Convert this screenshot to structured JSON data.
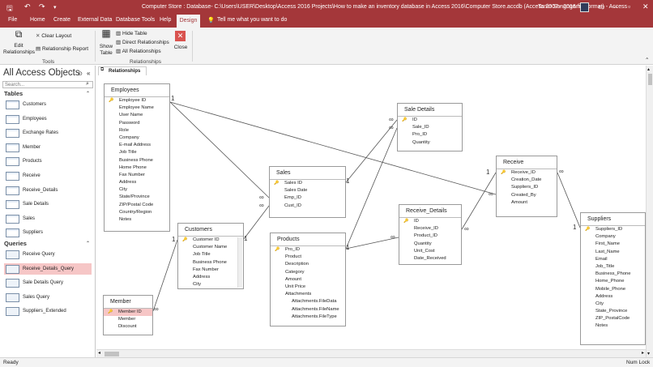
{
  "window": {
    "title": "Computer Store : Database- C:\\Users\\USER\\Desktop\\Access 2016 Projects\\How to make an inventory database in Access 2016\\Computer Store.accdb (Access 2007 - 2016 file format) - Access",
    "user": "Tanin Sangngam"
  },
  "ribbon_tabs": [
    "File",
    "Home",
    "Create",
    "External Data",
    "Database Tools",
    "Help",
    "Design"
  ],
  "tell_me": "Tell me what you want to do",
  "ribbon": {
    "edit_relationships": "Edit\nRelationships",
    "clear_layout": "Clear Layout",
    "relationship_report": "Relationship Report",
    "tools_group": "Tools",
    "show_table": "Show\nTable",
    "hide_table": "Hide Table",
    "direct_relationships": "Direct Relationships",
    "all_relationships": "All Relationships",
    "close": "Close",
    "relationships_group": "Relationships"
  },
  "nav": {
    "title": "All Access Objects",
    "search_placeholder": "Search...",
    "tables_header": "Tables",
    "queries_header": "Queries",
    "tables": [
      "Customers",
      "Employees",
      "Exchange Rates",
      "Member",
      "Products",
      "Receive",
      "Receive_Details",
      "Sale Details",
      "Sales",
      "Suppliers"
    ],
    "queries": [
      "Receive Query",
      "Receive_Details_Query",
      "Sale Details Query",
      "Sales Query",
      "Suppliers_Extended"
    ],
    "selected_query": "Receive_Details_Query"
  },
  "doc_tab": "Relationships",
  "tables": {
    "employees": {
      "name": "Employees",
      "fields": [
        "Employee ID",
        "Employee Name",
        "User Name",
        "Password",
        "Role",
        "Company",
        "E-mail Address",
        "Job Title",
        "Business Phone",
        "Home Phone",
        "Fax Number",
        "Address",
        "City",
        "State/Province",
        "ZIP/Postal Code",
        "Country/Region",
        "Notes"
      ]
    },
    "sale_details": {
      "name": "Sale Details",
      "fields": [
        "ID",
        "Sale_ID",
        "Pro_ID",
        "Quantity"
      ]
    },
    "receive": {
      "name": "Receive",
      "fields": [
        "Receive_ID",
        "Creation_Date",
        "Suppliers_ID",
        "Created_By",
        "Amount"
      ]
    },
    "sales": {
      "name": "Sales",
      "fields": [
        "Sales ID",
        "Sales Date",
        "Emp_ID",
        "Cust_ID"
      ]
    },
    "receive_details": {
      "name": "Receive_Details",
      "fields": [
        "ID",
        "Receive_ID",
        "Product_ID",
        "Quantity",
        "Unit_Cost",
        "Date_Received"
      ]
    },
    "customers": {
      "name": "Customers",
      "fields": [
        "Customer ID",
        "Customer Name",
        "Job Title",
        "Business Phone",
        "Fax Number",
        "Address",
        "City"
      ]
    },
    "products": {
      "name": "Products",
      "fields": [
        "Pro_ID",
        "Product",
        "Description",
        "Category",
        "Amount",
        "Unit Price",
        "Attachments",
        "Attachments.FileData",
        "Attachments.FileName",
        "Attachments.FileType"
      ]
    },
    "suppliers": {
      "name": "Suppliers",
      "fields": [
        "Suppliers_ID",
        "Company",
        "First_Name",
        "Last_Name",
        "Email",
        "Job_Title",
        "Business_Phone",
        "Home_Phone",
        "Mobile_Phone",
        "Address",
        "City",
        "State_Province",
        "ZIP_PostalCode",
        "Notes"
      ]
    },
    "member": {
      "name": "Member",
      "fields": [
        "Member ID",
        "Member",
        "Discount"
      ]
    }
  },
  "status": {
    "left": "Ready",
    "right": "Num Lock"
  },
  "colors": {
    "accent": "#a4373a",
    "highlight": "#f6c6c6"
  }
}
